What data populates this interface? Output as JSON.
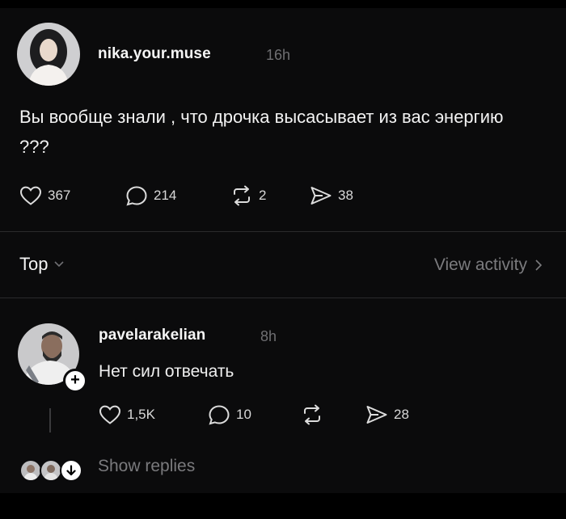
{
  "post": {
    "username": "nika.your.muse",
    "time": "16h",
    "text": "Вы вообще знали , что дрочка высасывает из вас энергию ???",
    "likes": "367",
    "comments": "214",
    "reposts": "2",
    "shares": "38"
  },
  "sort": {
    "label": "Top",
    "view_activity": "View activity"
  },
  "reply": {
    "username": "pavelarakelian",
    "time": "8h",
    "text": "Нет сил отвечать",
    "likes": "1,5K",
    "comments": "10",
    "shares": "28",
    "show_replies": "Show replies"
  }
}
